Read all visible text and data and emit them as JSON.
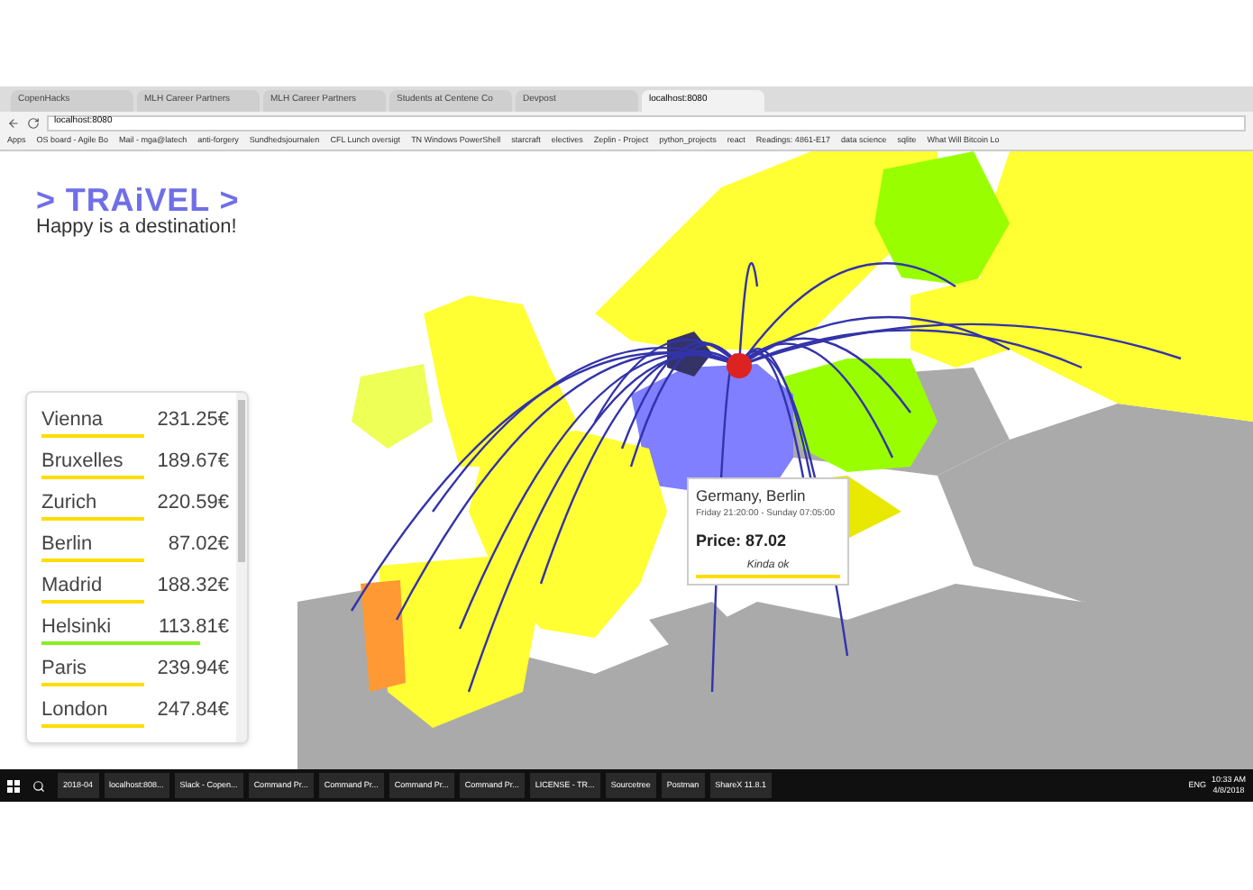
{
  "browser": {
    "tabs": [
      {
        "label": "CopenHacks",
        "selected": false
      },
      {
        "label": "MLH Career Partners",
        "selected": false
      },
      {
        "label": "MLH Career Partners",
        "selected": false
      },
      {
        "label": "Students at Centene Co",
        "selected": false
      },
      {
        "label": "Devpost",
        "selected": false
      },
      {
        "label": "localhost:8080",
        "selected": true
      }
    ],
    "address": "localhost:8080",
    "bookmarks": [
      "Apps",
      "OS board - Agile Bo",
      "Mail - mga@latech",
      "anti-forgery",
      "Sundhedsjournalen",
      "CFL Lunch oversigt",
      "TN Windows PowerShell",
      "starcraft",
      "electives",
      "Zeplin - Project",
      "python_projects",
      "react",
      "Readings: 4861-E17",
      "data science",
      "sqlite",
      "What Will Bitcoin Lo"
    ]
  },
  "header": {
    "logo": "> TRAiVEL >",
    "tagline": "Happy is a destination!"
  },
  "destinations": [
    {
      "city": "Vienna",
      "price": "231.25€",
      "color": "#ffdd00",
      "level": 0.55
    },
    {
      "city": "Bruxelles",
      "price": "189.67€",
      "color": "#ffdd00",
      "level": 0.55
    },
    {
      "city": "Zurich",
      "price": "220.59€",
      "color": "#ffdd00",
      "level": 0.55
    },
    {
      "city": "Berlin",
      "price": "87.02€",
      "color": "#ffdd00",
      "level": 0.55
    },
    {
      "city": "Madrid",
      "price": "188.32€",
      "color": "#ffdd00",
      "level": 0.55
    },
    {
      "city": "Helsinki",
      "price": "113.81€",
      "color": "#88ee22",
      "level": 0.85
    },
    {
      "city": "Paris",
      "price": "239.94€",
      "color": "#ffdd00",
      "level": 0.55
    },
    {
      "city": "London",
      "price": "247.84€",
      "color": "#ffdd00",
      "level": 0.55
    }
  ],
  "tooltip": {
    "title": "Germany, Berlin",
    "dates": "Friday 21:20:00 - Sunday 07:05:00",
    "price": "Price: 87.02",
    "verdict": "Kinda ok",
    "color": "#ffdd00"
  },
  "taskbar": {
    "items": [
      "2018-04",
      "localhost:808...",
      "Slack - Copen...",
      "Command Pr...",
      "Command Pr...",
      "Command Pr...",
      "Command Pr...",
      "LICENSE - TR...",
      "Sourcetree",
      "Postman",
      "ShareX 11.8.1"
    ],
    "language": "ENG",
    "time": "10:33 AM",
    "date": "4/8/2018"
  }
}
